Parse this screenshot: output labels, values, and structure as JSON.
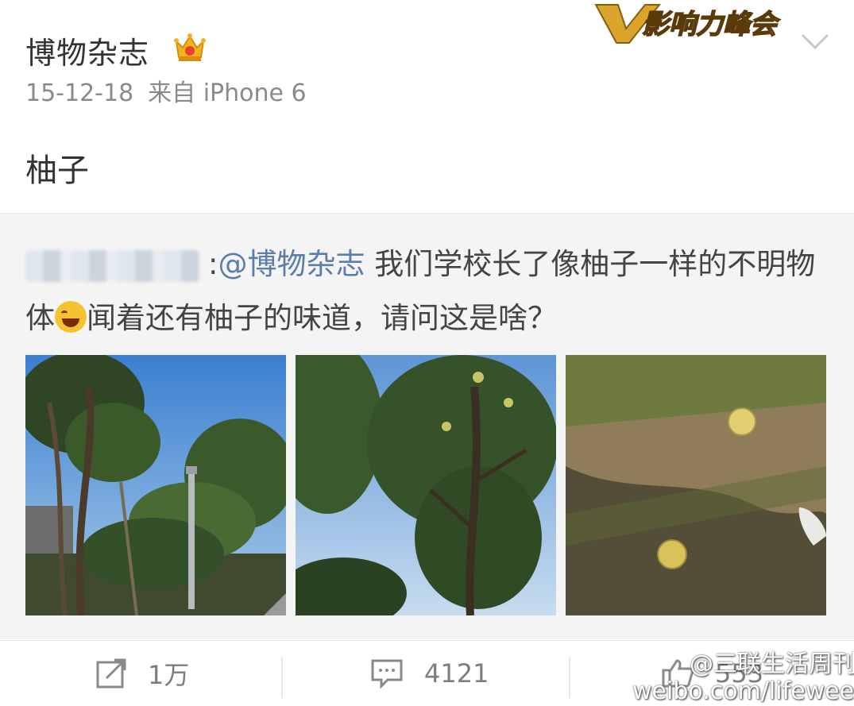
{
  "post": {
    "author": "博物杂志",
    "date": "15-12-18",
    "source": "来自 iPhone 6",
    "text": "柚子"
  },
  "event_badge": "影响力峰会",
  "icons": {
    "crown": "crown-icon",
    "more": "chevron-down-icon",
    "repost": "repost-icon",
    "comment": "comment-icon",
    "like": "thumbs-up-icon"
  },
  "quote": {
    "separator": ":",
    "mention": "@博物杂志",
    "text_part1": " 我们学校长了像柚子一样的不明物体",
    "text_part2": "闻着还有柚子的味道，请问这是啥？",
    "emoji": "laughing-tears-emoji"
  },
  "photos": [
    "campus-trees-photo",
    "pomelo-tree-photo",
    "fallen-pomelos-photo"
  ],
  "actions": {
    "repost_count": "1万",
    "comment_count": "4121",
    "like_count": "553"
  },
  "watermark": {
    "line1": "@三联生活周刊",
    "line2": "weibo.com/lifeweek"
  },
  "colors": {
    "link": "#5a7ea8",
    "quote_bg": "#f4f4f4",
    "badge_gold": "#d9a52a",
    "meta_gray": "#8a8a8a"
  }
}
